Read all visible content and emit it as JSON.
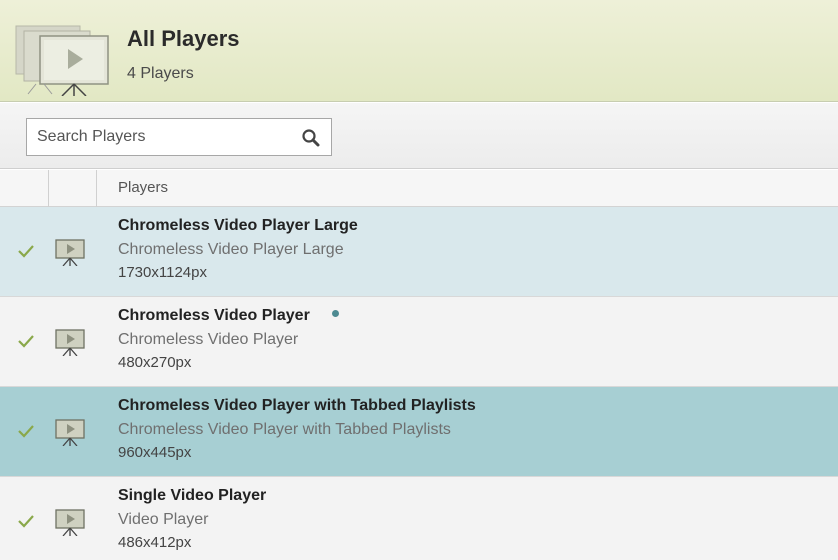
{
  "header": {
    "title": "All Players",
    "count": "4 Players",
    "icon": "video-player-stack-icon"
  },
  "search": {
    "placeholder": "Search Players",
    "value": "",
    "icon": "search-icon"
  },
  "table": {
    "column_title": "Players",
    "rows": [
      {
        "name": "Chromeless Video Player Large",
        "description": "Chromeless Video Player Large",
        "size": "1730x1124px",
        "checked": true,
        "style": "light",
        "has_dot": false
      },
      {
        "name": "Chromeless Video Player",
        "description": "Chromeless Video Player",
        "size": "480x270px",
        "checked": true,
        "style": "plain",
        "has_dot": true
      },
      {
        "name": "Chromeless Video Player with Tabbed Playlists",
        "description": "Chromeless Video Player with Tabbed Playlists",
        "size": "960x445px",
        "checked": true,
        "style": "dark",
        "has_dot": false
      },
      {
        "name": "Single Video Player",
        "description": "Video Player",
        "size": "486x412px",
        "checked": true,
        "style": "plain",
        "has_dot": false
      }
    ]
  },
  "colors": {
    "header_bg": "#e6ebca",
    "row_light": "#d9e8ec",
    "row_selected": "#a7cfd3",
    "row_plain": "#f3f3f3",
    "check": "#8aa84a",
    "status_dot": "#4d8a91"
  }
}
